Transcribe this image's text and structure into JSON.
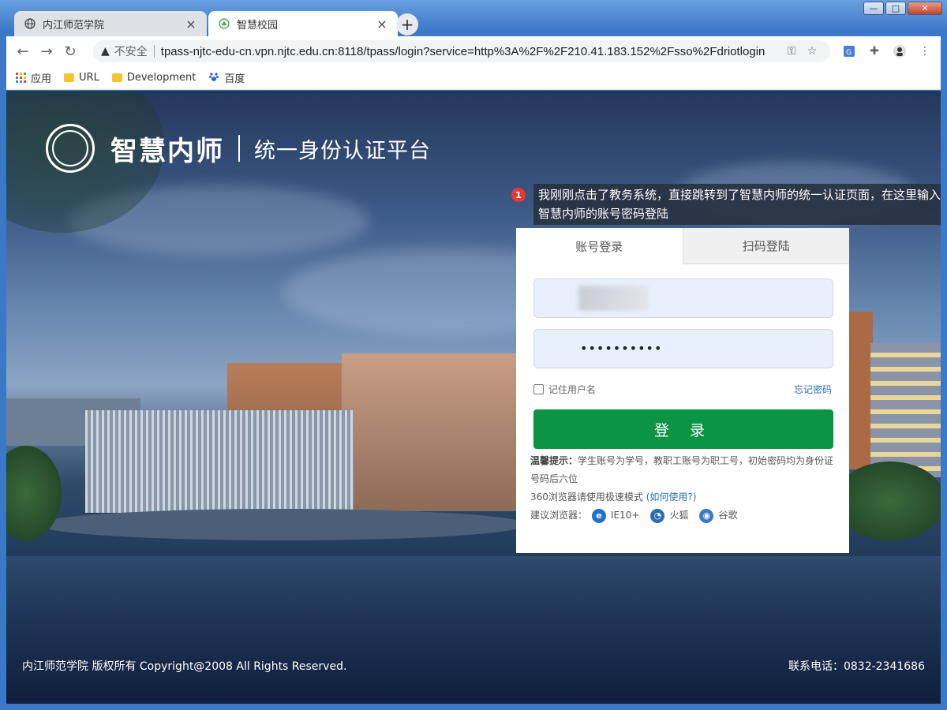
{
  "browser": {
    "tabs": [
      {
        "title": "内江师范学院",
        "icon": "globe-icon",
        "active": false
      },
      {
        "title": "智慧校园",
        "icon": "school-icon",
        "active": true
      }
    ],
    "new_tab_symbol": "+",
    "security_label": "不安全",
    "url": "tpass-njtc-edu-cn.vpn.njtc.edu.cn:8118/tpass/login?service=http%3A%2F%2F210.41.183.152%2Fsso%2Fdriotlogin",
    "bookmarks": [
      {
        "label": "应用",
        "icon": "apps-icon"
      },
      {
        "label": "URL",
        "icon": "folder-icon"
      },
      {
        "label": "Development",
        "icon": "folder-icon"
      },
      {
        "label": "百度",
        "icon": "baidu-paw-icon"
      }
    ]
  },
  "header": {
    "brand": "智慧内师",
    "subtitle": "统一身份认证平台"
  },
  "annotation": {
    "number": "1",
    "text": "我刚刚点击了教务系统，直接跳转到了智慧内师的统一认证页面，在这里输入智慧内师的账号密码登陆"
  },
  "login": {
    "tabs": [
      {
        "label": "账号登录",
        "active": true
      },
      {
        "label": "扫码登陆",
        "active": false
      }
    ],
    "username_value": "",
    "password_mask": "••••••••••",
    "remember_label": "记住用户名",
    "forgot_label": "忘记密码",
    "submit_label": "登 录",
    "tip_heading": "温馨提示：",
    "tip_text": "学生账号为学号，教职工账号为职工号，初始密码均为身份证号码后六位",
    "browser_note": "360浏览器请使用极速模式",
    "browser_note_link": "(如何使用?)",
    "recommended_label": "建议浏览器：",
    "recommended": [
      {
        "name": "IE10+",
        "icon": "ie-icon",
        "color": "#1e73c9"
      },
      {
        "name": "火狐",
        "icon": "firefox-icon",
        "color": "#2a6fb5"
      },
      {
        "name": "谷歌",
        "icon": "chrome-icon",
        "color": "#3a78c8"
      }
    ]
  },
  "footer": {
    "copyright": "内江师范学院 版权所有 Copyright@2008 All Rights Reserved.",
    "contact": "联系电话：0832-2341686"
  },
  "colors": {
    "login_button": "#0b9444",
    "link": "#2a6fb5",
    "annotation_bg": "#283241",
    "annotation_badge": "#e53935"
  }
}
